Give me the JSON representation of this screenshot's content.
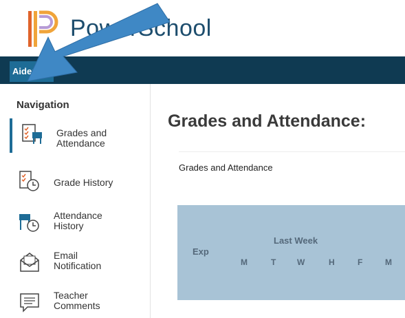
{
  "app": {
    "brand": "PowerSchool"
  },
  "topbar": {
    "student_name": "Aiden"
  },
  "sidebar": {
    "title": "Navigation",
    "items": [
      {
        "label": "Grades and Attendance",
        "icon": "grades-attendance-icon",
        "active": true
      },
      {
        "label": "Grade History",
        "icon": "grade-history-icon",
        "active": false
      },
      {
        "label": "Attendance History",
        "icon": "attendance-history-icon",
        "active": false
      },
      {
        "label": "Email Notification",
        "icon": "email-notification-icon",
        "active": false
      },
      {
        "label": "Teacher Comments",
        "icon": "teacher-comments-icon",
        "active": false
      }
    ]
  },
  "main": {
    "title": "Grades and Attendance:",
    "breadcrumb": "Grades and Attendance",
    "table": {
      "exp_header": "Exp",
      "last_week_header": "Last Week",
      "days": [
        "M",
        "T",
        "W",
        "H",
        "F",
        "M"
      ]
    }
  },
  "colors": {
    "topbar": "#0f3a52",
    "student_tab": "#1e6c96",
    "annotation_arrow": "#3f88c5",
    "table_header_bg": "#a8c3d6"
  }
}
